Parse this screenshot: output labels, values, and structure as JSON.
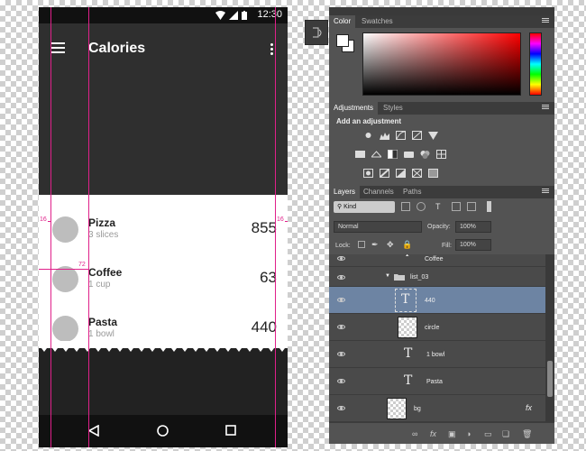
{
  "status_bar": {
    "time": "12:30"
  },
  "app": {
    "title": "Calories",
    "items": [
      {
        "name": "Pizza",
        "detail": "3 slices",
        "calories": "855"
      },
      {
        "name": "Coffee",
        "detail": "1 cup",
        "calories": "63"
      },
      {
        "name": "Pasta",
        "detail": "1 bowl",
        "calories": "440"
      }
    ]
  },
  "guides": {
    "left_margin": "16",
    "right_margin": "16",
    "text_inset": "72"
  },
  "accent_color": "#e0208a",
  "photoshop": {
    "color_tabs": [
      "Color",
      "Swatches"
    ],
    "adjustments_tabs": [
      "Adjustments",
      "Styles"
    ],
    "adjustments_heading": "Add an adjustment",
    "layers_tabs": [
      "Layers",
      "Channels",
      "Paths"
    ],
    "filter_kind": "Kind",
    "blend_mode": "Normal",
    "opacity_label": "Opacity:",
    "opacity_value": "100%",
    "lock_label": "Lock:",
    "fill_label": "Fill:",
    "fill_value": "100%",
    "layers": [
      {
        "name": "Coffee",
        "kind": "text"
      },
      {
        "name": "list_03",
        "kind": "group"
      },
      {
        "name": "440",
        "kind": "text",
        "selected": true
      },
      {
        "name": "circle",
        "kind": "shape"
      },
      {
        "name": "1 bowl",
        "kind": "text"
      },
      {
        "name": "Pasta",
        "kind": "text"
      },
      {
        "name": "bg",
        "kind": "shape"
      }
    ],
    "fx_label": "fx"
  }
}
